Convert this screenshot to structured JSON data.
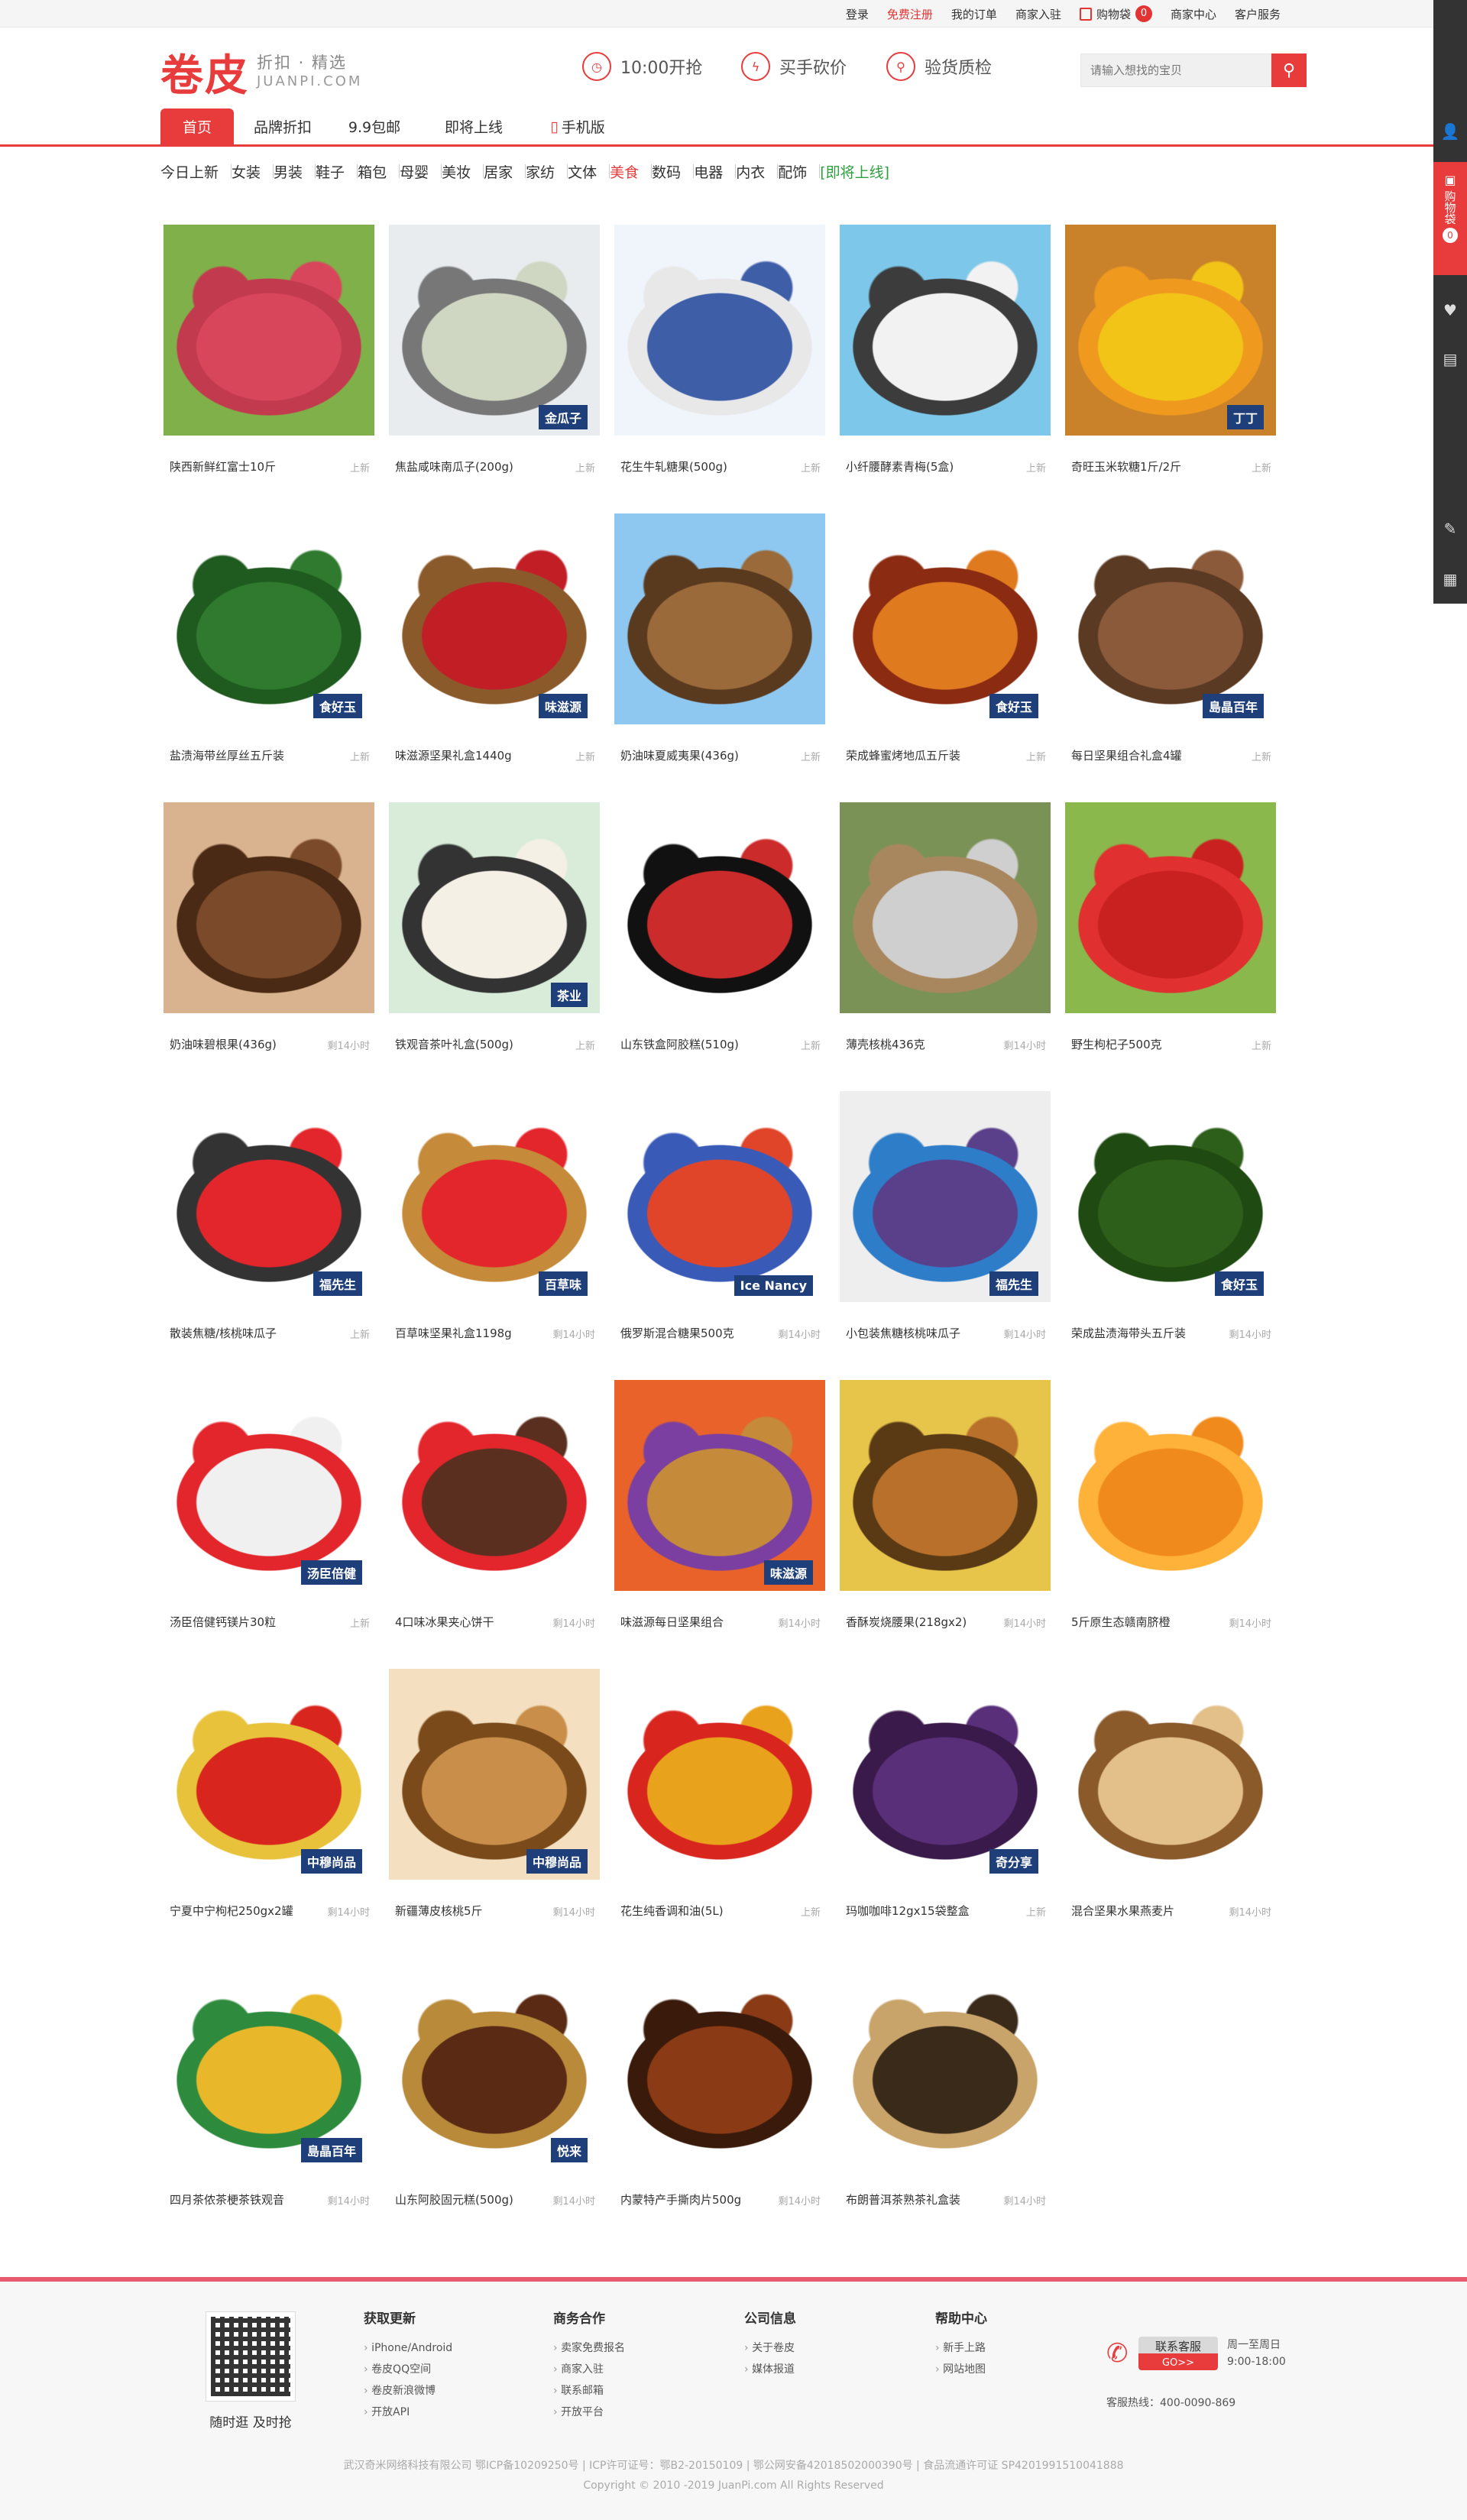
{
  "topbar": {
    "links": [
      "登录",
      "免费注册",
      "我的订单",
      "商家入驻",
      "购物袋",
      "商家中心",
      "客户服务"
    ],
    "cart_count": "0"
  },
  "header": {
    "logo": "卷皮",
    "tagline": "折扣 · 精选",
    "domain": "JUANPI.COM",
    "features": [
      "10:00开抢",
      "买手砍价",
      "验货质检"
    ],
    "search_placeholder": "请输入想找的宝贝"
  },
  "nav": {
    "items": [
      "首页",
      "品牌折扣",
      "9.9包邮",
      "即将上线",
      "手机版"
    ]
  },
  "categories": [
    "今日上新",
    "女装",
    "男装",
    "鞋子",
    "箱包",
    "母婴",
    "美妆",
    "居家",
    "家纺",
    "文体",
    "美食",
    "数码",
    "电器",
    "内衣",
    "配饰",
    "[即将上线]"
  ],
  "products": [
    {
      "title": "陕西新鲜红富士10斤",
      "status": "上新",
      "colors": [
        "#7fb04a",
        "#d8465c",
        "#c23a4e"
      ]
    },
    {
      "title": "焦盐咸味南瓜子(200g)",
      "status": "上新",
      "colors": [
        "#e9ecef",
        "#cfd6c2",
        "#777"
      ]
    },
    {
      "title": "花生牛轧糖果(500g)",
      "status": "上新",
      "colors": [
        "#f0f4fb",
        "#3e5ea8",
        "#e8e8e8"
      ]
    },
    {
      "title": "小纤腰酵素青梅(5盒)",
      "status": "上新",
      "colors": [
        "#7cc7ea",
        "#f2f2f2",
        "#3c3c3c"
      ]
    },
    {
      "title": "奇旺玉米软糖1斤/2斤",
      "status": "上新",
      "colors": [
        "#c9822a",
        "#f2c418",
        "#ef9a1f"
      ]
    },
    {
      "title": "盐渍海带丝厚丝五斤装",
      "status": "上新",
      "colors": [
        "#ffffff",
        "#2f7a2f",
        "#1f5a1f"
      ]
    },
    {
      "title": "味滋源坚果礼盒1440g",
      "status": "上新",
      "colors": [
        "#ffffff",
        "#c21e26",
        "#8b5a2b"
      ]
    },
    {
      "title": "奶油味夏威夷果(436g)",
      "status": "上新",
      "colors": [
        "#8ec7f0",
        "#9a6a3a",
        "#5a3a1e"
      ]
    },
    {
      "title": "荣成蜂蜜烤地瓜五斤装",
      "status": "上新",
      "colors": [
        "#ffffff",
        "#e07a1f",
        "#8a2b12"
      ]
    },
    {
      "title": "每日坚果组合礼盒4罐",
      "status": "上新",
      "colors": [
        "#ffffff",
        "#8b5a3a",
        "#5a3a22"
      ]
    },
    {
      "title": "奶油味碧根果(436g)",
      "status": "剩14小时",
      "colors": [
        "#d9b38f",
        "#7a4a2a",
        "#4a2a14"
      ]
    },
    {
      "title": "铁观音茶叶礼盒(500g)",
      "status": "上新",
      "colors": [
        "#d8ecd9",
        "#f4f0e6",
        "#333"
      ]
    },
    {
      "title": "山东铁盒阿胶糕(510g)",
      "status": "上新",
      "colors": [
        "#ffffff",
        "#cc2b2b",
        "#111"
      ]
    },
    {
      "title": "薄壳核桃436克",
      "status": "剩14小时",
      "colors": [
        "#7b9256",
        "#cfcfcf",
        "#a8875e"
      ]
    },
    {
      "title": "野生枸杞子500克",
      "status": "上新",
      "colors": [
        "#8ab84c",
        "#c8211f",
        "#e03030"
      ]
    },
    {
      "title": "散装焦糖/核桃味瓜子",
      "status": "上新",
      "colors": [
        "#ffffff",
        "#e3262b",
        "#333"
      ]
    },
    {
      "title": "百草味坚果礼盒1198g",
      "status": "剩14小时",
      "colors": [
        "#ffffff",
        "#e3262b",
        "#c58a3a"
      ]
    },
    {
      "title": "俄罗斯混合糖果500克",
      "status": "剩14小时",
      "colors": [
        "#ffffff",
        "#e0452a",
        "#3a5ab8"
      ]
    },
    {
      "title": "小包装焦糖核桃味瓜子",
      "status": "剩14小时",
      "colors": [
        "#eeeeee",
        "#5a3f8a",
        "#2e7dc9"
      ]
    },
    {
      "title": "荣成盐渍海带头五斤装",
      "status": "剩14小时",
      "colors": [
        "#ffffff",
        "#2d5e1a",
        "#1f4a12"
      ]
    },
    {
      "title": "汤臣倍健钙镁片30粒",
      "status": "上新",
      "colors": [
        "#ffffff",
        "#f0f0f0",
        "#e3262b"
      ]
    },
    {
      "title": "4口味冰果夹心饼干",
      "status": "剩14小时",
      "colors": [
        "#ffffff",
        "#5a2f1f",
        "#e3262b"
      ]
    },
    {
      "title": "味滋源每日坚果组合",
      "status": "剩14小时",
      "colors": [
        "#e8622a",
        "#c58a3a",
        "#7a3fa0"
      ]
    },
    {
      "title": "香酥炭烧腰果(218gx2)",
      "status": "剩14小时",
      "colors": [
        "#e7c44a",
        "#b8702a",
        "#5a3a14"
      ]
    },
    {
      "title": "5斤原生态赣南脐橙",
      "status": "剩14小时",
      "colors": [
        "#ffffff",
        "#f08a1c",
        "#ffb23a"
      ]
    },
    {
      "title": "宁夏中宁枸杞250gx2罐",
      "status": "剩14小时",
      "colors": [
        "#ffffff",
        "#d8261f",
        "#e8c23a"
      ]
    },
    {
      "title": "新疆薄皮核桃5斤",
      "status": "剩14小时",
      "colors": [
        "#f4e0c0",
        "#c98f4a",
        "#7a4a1a"
      ]
    },
    {
      "title": "花生纯香调和油(5L)",
      "status": "上新",
      "colors": [
        "#ffffff",
        "#e8a21c",
        "#d8261f"
      ]
    },
    {
      "title": "玛咖咖啡12gx15袋整盒",
      "status": "上新",
      "colors": [
        "#ffffff",
        "#5a2f7a",
        "#3a1a4a"
      ]
    },
    {
      "title": "混合坚果水果燕麦片",
      "status": "剩14小时",
      "colors": [
        "#ffffff",
        "#e3c08a",
        "#8b5a2b"
      ]
    },
    {
      "title": "四月茶侬茶梗茶铁观音",
      "status": "剩14小时",
      "colors": [
        "#ffffff",
        "#e8b82a",
        "#2e8b3e"
      ]
    },
    {
      "title": "山东阿胶固元糕(500g)",
      "status": "剩14小时",
      "colors": [
        "#ffffff",
        "#5a2a14",
        "#b88a3a"
      ]
    },
    {
      "title": "内蒙特产手撕肉片500g",
      "status": "剩14小时",
      "colors": [
        "#ffffff",
        "#8a3a14",
        "#3a1a0a"
      ]
    },
    {
      "title": "布朗普洱茶熟茶礼盒装",
      "status": "剩14小时",
      "colors": [
        "#ffffff",
        "#3a2a1a",
        "#c9a46a"
      ]
    }
  ],
  "badges": {
    "1": "金瓜子",
    "4": "丁丁",
    "5": "食好玉",
    "6": "味滋源",
    "8": "食好玉",
    "9": "島晶百年",
    "11": "茶业",
    "15": "福先生",
    "16": "百草味",
    "17": "Ice Nancy",
    "18": "福先生",
    "19": "食好玉",
    "20": "汤臣倍健",
    "22": "味滋源",
    "25": "中穆尚品",
    "26": "中穆尚品",
    "28": "奇分享",
    "30": "島晶百年",
    "31": "悦来"
  },
  "footer": {
    "qr_label": "随时逛 及时抢",
    "columns": [
      {
        "title": "获取更新",
        "items": [
          "iPhone/Android",
          "卷皮QQ空间",
          "卷皮新浪微博",
          "开放API"
        ]
      },
      {
        "title": "商务合作",
        "items": [
          "卖家免费报名",
          "商家入驻",
          "联系邮箱",
          "开放平台"
        ]
      },
      {
        "title": "公司信息",
        "items": [
          "关于卷皮",
          "媒体报道"
        ]
      },
      {
        "title": "帮助中心",
        "items": [
          "新手上路",
          "网站地图"
        ]
      }
    ],
    "contact_label": "联系客服",
    "contact_go": "GO>>",
    "hours_days": "周一至周日",
    "hours_time": "9:00-18:00",
    "hotline": "客服热线：400-0090-869",
    "legal_1": "武汉奇米网络科技有限公司 鄂ICP备10209250号 | ICP许可证号：鄂B2-20150109 | 鄂公网安备42018502000390号 | 食品流通许可证 SP4201991510041888",
    "legal_2": "Copyright © 2010 -2019 JuanPi.com All Rights Reserved"
  },
  "rightbar": {
    "cart_label": "购物袋",
    "cart_count": "0"
  }
}
